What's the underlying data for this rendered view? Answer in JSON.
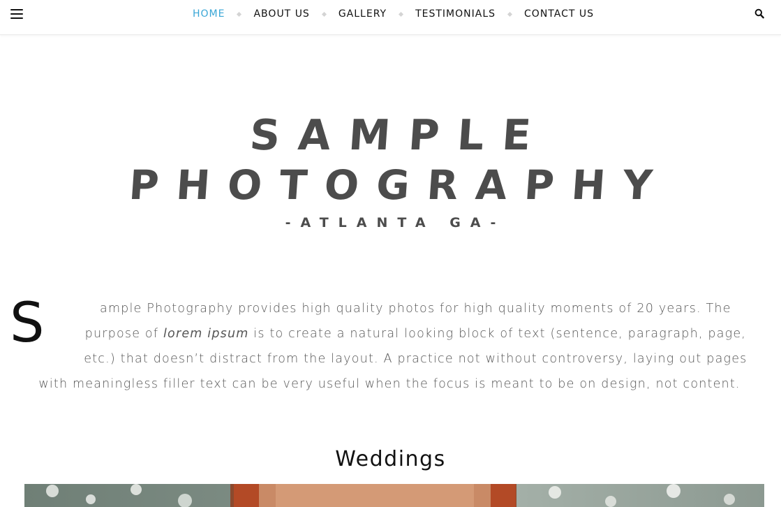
{
  "nav": {
    "items": [
      {
        "label": "HOME",
        "active": true
      },
      {
        "label": "ABOUT US",
        "active": false
      },
      {
        "label": "GALLERY",
        "active": false
      },
      {
        "label": "TESTIMONIALS",
        "active": false
      },
      {
        "label": "CONTACT US",
        "active": false
      }
    ],
    "active_color": "#39a6d6",
    "menu_icon": "hamburger-icon",
    "search_icon": "search-icon"
  },
  "logo": {
    "line1": "SAMPLE",
    "line2": "PHOTOGRAPHY",
    "line3": "-ATLANTA GA-"
  },
  "intro": {
    "drop_cap": "S",
    "text_before_em": "ample Photography provides high quality photos for high quality moments of 20 years. The purpose of ",
    "em_text": "lorem ipsum",
    "text_after_em": " is to create a natural looking block of text (sentence, paragraph, page, etc.) that doesn’t distract from the layout. A practice not without controversy, laying out pages with meaningless filler text can be very useful when the focus is meant to be on design, not content."
  },
  "weddings": {
    "title": "Weddings"
  }
}
